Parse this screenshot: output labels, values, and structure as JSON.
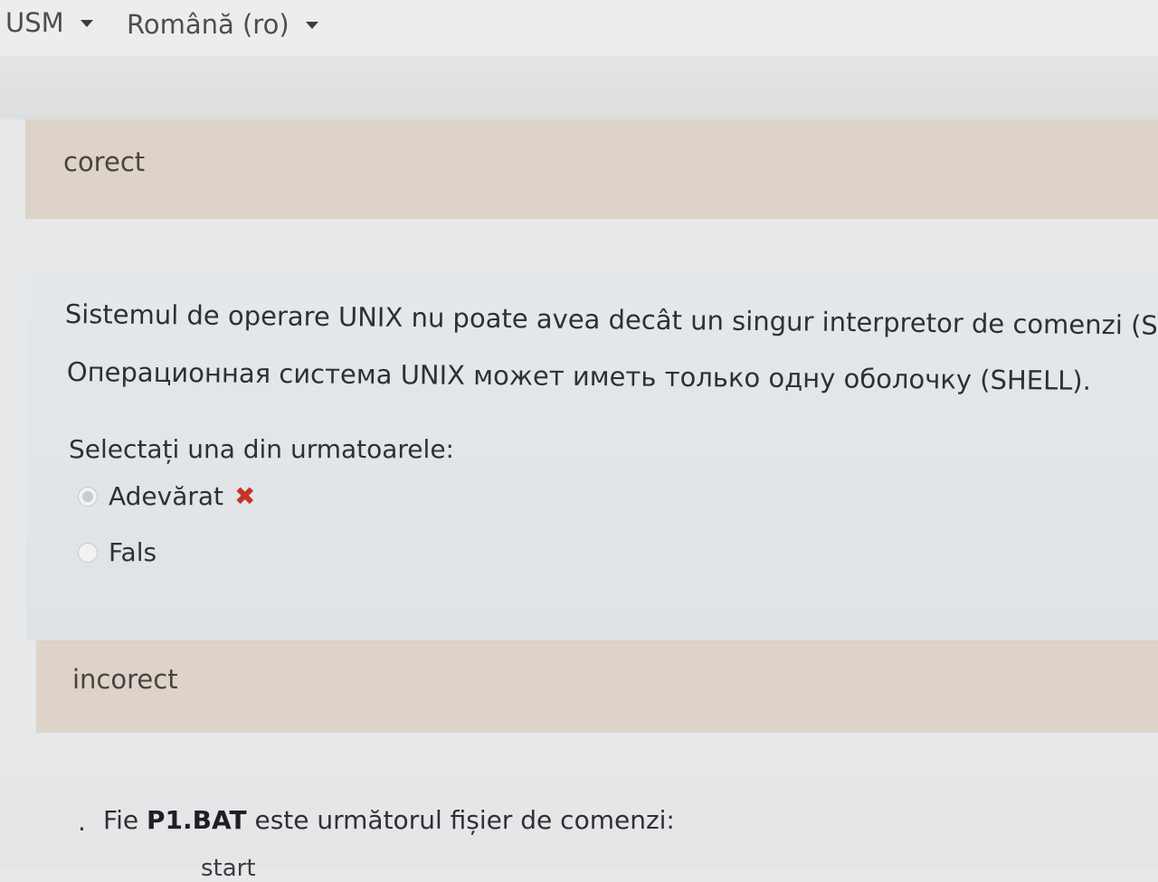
{
  "header": {
    "site_menu": "USM",
    "language_menu": "Română (ro)"
  },
  "previous_feedback": "corect",
  "question": {
    "text_ro": "Sistemul de operare UNIX nu poate avea decât un singur interpretor de comenzi (SHELL).",
    "text_ru": "Операционная система UNIX может иметь только одну оболочку (SHELL).",
    "prompt": "Selectați una din urmatoarele:",
    "options": [
      {
        "label": "Adevărat",
        "selected": true,
        "mark": "wrong-icon"
      },
      {
        "label": "Fals",
        "selected": false
      }
    ],
    "feedback": "incorect"
  },
  "next_question": {
    "bullet": ".",
    "prefix": "Fie ",
    "filename": "P1.BAT",
    "suffix": " este următorul fișier de comenzi:",
    "fragment": "start"
  },
  "colors": {
    "feedback_bg": "#ddd3c8",
    "wrong_mark": "#c5342a"
  }
}
